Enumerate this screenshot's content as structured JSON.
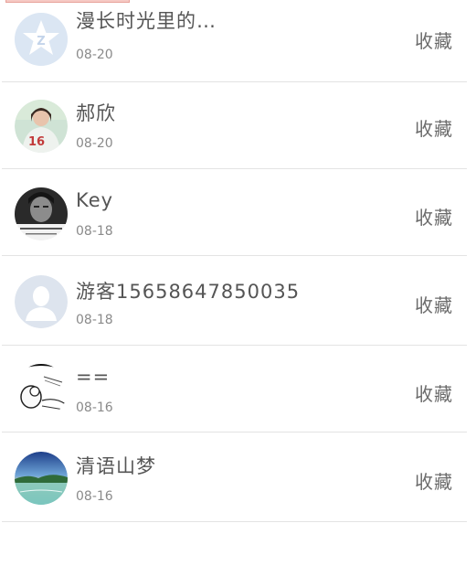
{
  "items": [
    {
      "name": "漫长时光里的…",
      "date": "08-20",
      "action": "收藏",
      "avatar": "star-logo-avatar"
    },
    {
      "name": "郝欣",
      "date": "08-20",
      "action": "收藏",
      "avatar": "girl-jersey-avatar"
    },
    {
      "name": "Key",
      "date": "08-18",
      "action": "收藏",
      "avatar": "bw-portrait-avatar"
    },
    {
      "name": "游客15658647850035",
      "date": "08-18",
      "action": "收藏",
      "avatar": "default-person-avatar"
    },
    {
      "name": "==",
      "date": "08-16",
      "action": "收藏",
      "avatar": "sketch-avatar"
    },
    {
      "name": "清语山梦",
      "date": "08-16",
      "action": "收藏",
      "avatar": "landscape-avatar"
    }
  ]
}
